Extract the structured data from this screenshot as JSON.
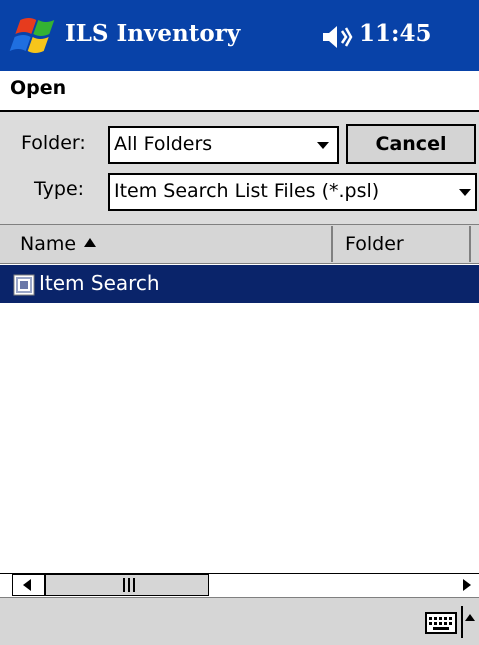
{
  "titlebar": {
    "app_title": "ILS Inventory",
    "clock": "11:45",
    "color": "#0842a8"
  },
  "dialog": {
    "title": "Open"
  },
  "form": {
    "folder_label": "Folder:",
    "folder_value": "All Folders",
    "type_label": "Type:",
    "type_value": "Item Search List Files (*.psl)",
    "cancel_label": "Cancel"
  },
  "list": {
    "columns": [
      "Name",
      "Folder"
    ],
    "sort_column": "Name",
    "sort_direction": "ascending",
    "rows": [
      {
        "name": "Item Search",
        "icon": "document-icon",
        "selected": true
      }
    ],
    "selection_color": "#0a246a"
  },
  "icons": {
    "start": "windows-flag-icon",
    "sound": "speaker-icon",
    "input": "keyboard-icon"
  }
}
